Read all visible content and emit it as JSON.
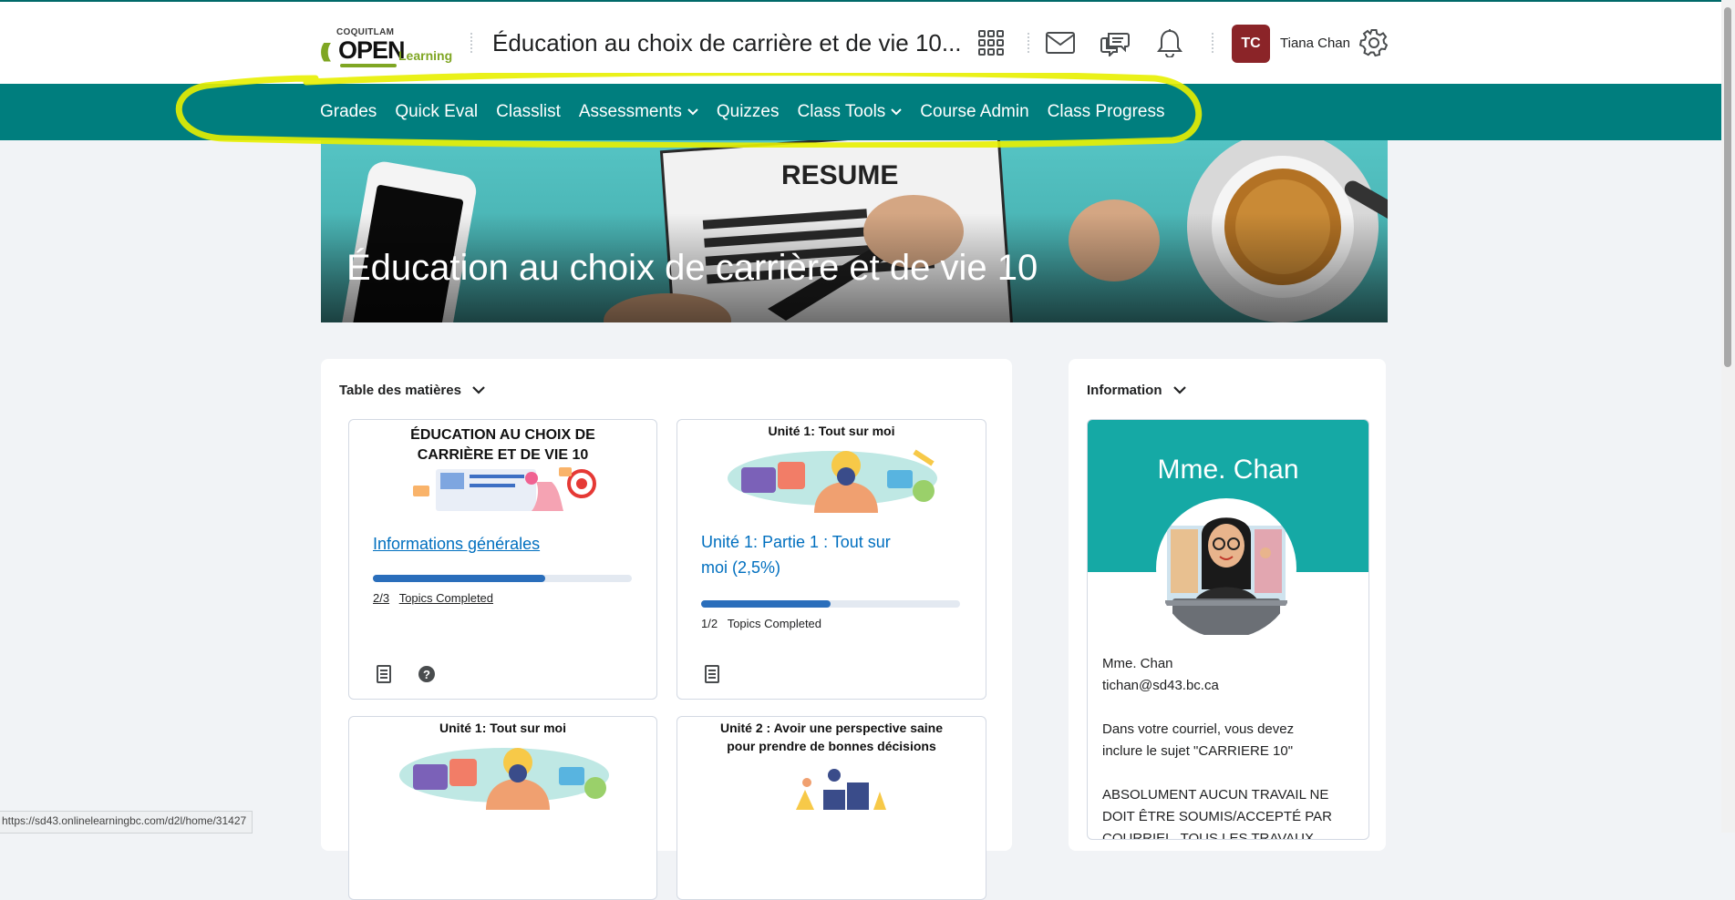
{
  "header": {
    "logo_small": "COQUITLAM",
    "logo_big": "OPEN",
    "logo_learning": "Learning",
    "course_title": "Éducation au choix de carrière et de vie 10...",
    "user_initials": "TC",
    "user_name": "Tiana Chan"
  },
  "nav": {
    "items": [
      {
        "label": "Grades"
      },
      {
        "label": "Quick Eval"
      },
      {
        "label": "Classlist"
      },
      {
        "label": "Assessments"
      },
      {
        "label": "Quizzes"
      },
      {
        "label": "Class Tools"
      },
      {
        "label": "Course Admin"
      },
      {
        "label": "Class Progress"
      }
    ],
    "highlight_color": "#e8f000"
  },
  "banner": {
    "resume_text": "RESUME",
    "title": "Éducation au choix de carrière et de vie 10"
  },
  "toc": {
    "heading": "Table des matières",
    "cards": [
      {
        "image_title_line1": "ÉDUCATION AU CHOIX DE",
        "image_title_line2": "CARRIÈRE ET DE VIE 10",
        "link": "Informations générales",
        "progress_fraction": 0.667,
        "progress_count": "2/3",
        "progress_label": "Topics Completed"
      },
      {
        "image_title_line1": "Unité 1: Tout sur moi",
        "link_line1": "Unité 1: Partie 1 : Tout sur",
        "link_line2": "moi (2,5%)",
        "progress_fraction": 0.5,
        "progress_count": "1/2",
        "progress_label": "Topics Completed"
      },
      {
        "image_title_line1": "Unité 1: Tout sur moi"
      },
      {
        "image_title_line1": "Unité 2 : Avoir une perspective saine",
        "image_title_line2": "pour prendre de bonnes décisions"
      }
    ]
  },
  "info": {
    "heading": "Information",
    "name_title": "Mme. Chan",
    "contact_name": "Mme. Chan",
    "contact_email": "tichan@sd43.bc.ca",
    "para1_line1": "Dans votre courriel, vous devez",
    "para1_line2": "inclure le sujet \"CARRIERE 10\"",
    "para2_line1": "ABSOLUMENT AUCUN TRAVAIL NE",
    "para2_line2": "DOIT ÊTRE SOUMIS/ACCEPTÉ PAR",
    "para2_line3": "COURRIEL. TOUS LES TRAVAUX"
  },
  "status_url": "https://sd43.onlinelearningbc.com/d2l/home/31427",
  "colors": {
    "nav_bg": "#007e7e",
    "avatar_bg": "#8b2428",
    "link": "#006fbf",
    "progress": "#2a6ebb",
    "info_teal": "#15a9a5"
  }
}
